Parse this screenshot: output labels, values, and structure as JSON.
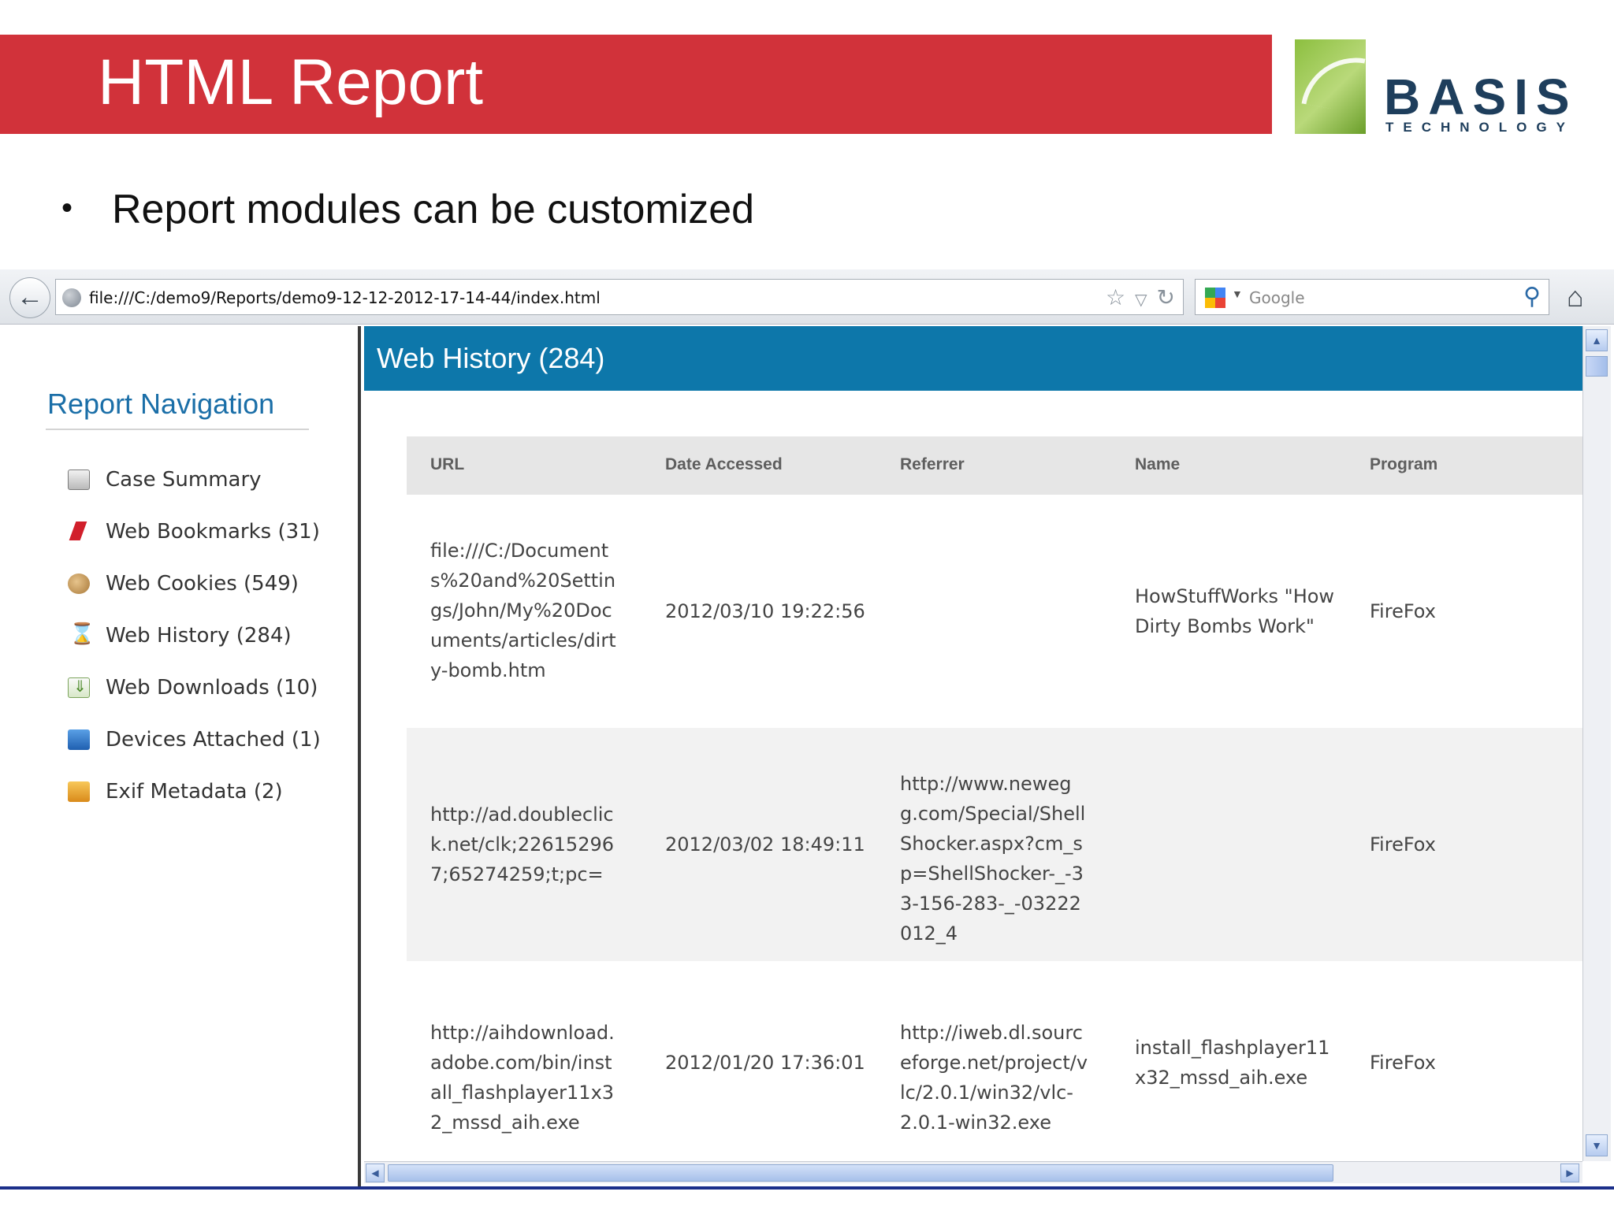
{
  "slide": {
    "title": "HTML Report",
    "logo": {
      "word": "BASIS",
      "sub": "TECHNOLOGY"
    },
    "bullet": "Report modules can be customized"
  },
  "browser": {
    "url": "file:///C:/demo9/Reports/demo9-12-12-2012-17-14-44/index.html",
    "search_placeholder": "Google"
  },
  "nav": {
    "title": "Report Navigation",
    "items": [
      {
        "label": "Case Summary",
        "icon": "briefcase-icon"
      },
      {
        "label": "Web Bookmarks (31)",
        "icon": "bookmark-icon"
      },
      {
        "label": "Web Cookies (549)",
        "icon": "cookie-icon"
      },
      {
        "label": "Web History (284)",
        "icon": "hourglass-icon"
      },
      {
        "label": "Web Downloads (10)",
        "icon": "download-icon"
      },
      {
        "label": "Devices Attached (1)",
        "icon": "device-icon"
      },
      {
        "label": "Exif Metadata (2)",
        "icon": "camera-icon"
      }
    ]
  },
  "main": {
    "section_title": "Web History (284)",
    "columns": [
      "URL",
      "Date Accessed",
      "Referrer",
      "Name",
      "Program"
    ],
    "rows": [
      {
        "url": "file:///C:/Documents%20and%20Settings/John/My%20Documents/articles/dirty-bomb.htm",
        "date": "2012/03/10 19:22:56",
        "referrer": "",
        "name": "HowStuffWorks \"How Dirty Bombs Work\"",
        "program": "FireFox"
      },
      {
        "url": "http://ad.doubleclick.net/clk;226152967;65274259;t;pc=",
        "date": "2012/03/02 18:49:11",
        "referrer": "http://www.newegg.com/Special/ShellShocker.aspx?cm_sp=ShellShocker-_-33-156-283-_-03222012_4",
        "name": "",
        "program": "FireFox"
      },
      {
        "url": "http://aihdownload.adobe.com/bin/install_flashplayer11x32_mssd_aih.exe",
        "date": "2012/01/20 17:36:01",
        "referrer": "http://iweb.dl.sourceforge.net/project/vlc/2.0.1/win32/vlc-2.0.1-win32.exe",
        "name": "install_flashplayer11x32_mssd_aih.exe",
        "program": "FireFox"
      }
    ]
  }
}
